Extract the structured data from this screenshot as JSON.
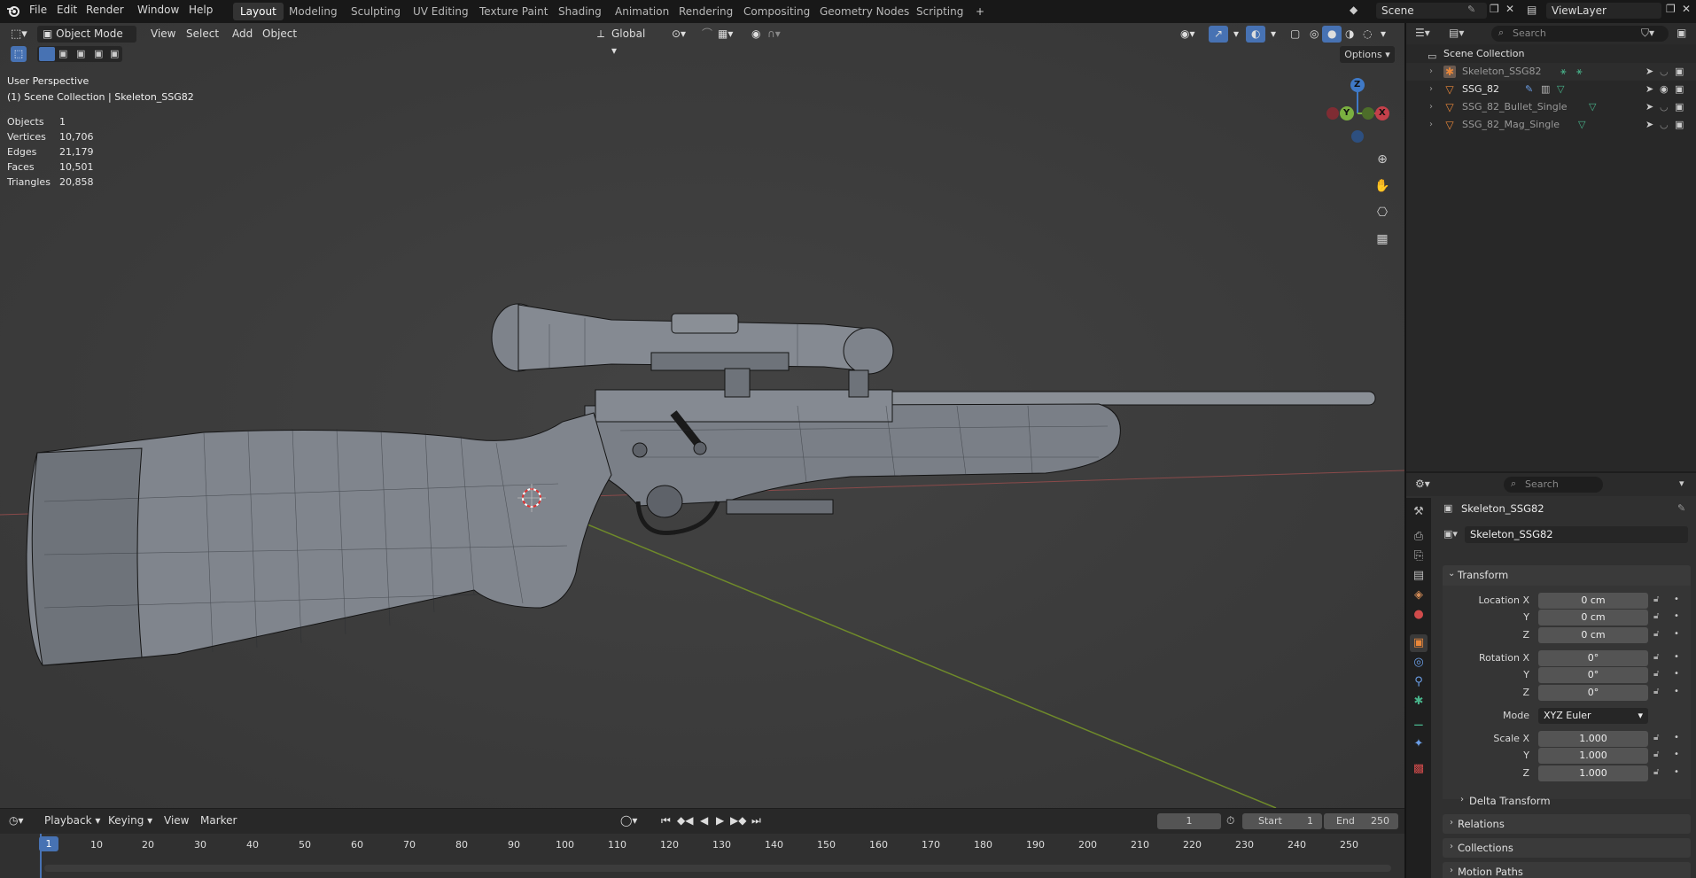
{
  "topbar": {
    "menu": [
      "File",
      "Edit",
      "Render",
      "Window",
      "Help"
    ],
    "workspaces": [
      "Layout",
      "Modeling",
      "Sculpting",
      "UV Editing",
      "Texture Paint",
      "Shading",
      "Animation",
      "Rendering",
      "Compositing",
      "Geometry Nodes",
      "Scripting"
    ],
    "active_workspace": "Layout",
    "add_tab": "+",
    "scene": "Scene",
    "view_layer": "ViewLayer"
  },
  "viewport": {
    "mode": "Object Mode",
    "menus": [
      "View",
      "Select",
      "Add",
      "Object"
    ],
    "orientation": "Global",
    "options_label": "Options",
    "perspective": "User Perspective",
    "collection_path": "(1) Scene Collection | Skeleton_SSG82",
    "stats": [
      {
        "label": "Objects",
        "value": "1"
      },
      {
        "label": "Vertices",
        "value": "10,706"
      },
      {
        "label": "Edges",
        "value": "21,179"
      },
      {
        "label": "Faces",
        "value": "10,501"
      },
      {
        "label": "Triangles",
        "value": "20,858"
      }
    ],
    "gizmo": {
      "z": "Z",
      "y": "Y",
      "x": "X"
    }
  },
  "outliner": {
    "search_placeholder": "Search",
    "root": "Scene Collection",
    "items": [
      {
        "name": "Skeleton_SSG82",
        "type": "armature",
        "dim": true
      },
      {
        "name": "SSG_82",
        "type": "mesh",
        "dim": false
      },
      {
        "name": "SSG_82_Bullet_Single",
        "type": "mesh",
        "dim": true
      },
      {
        "name": "SSG_82_Mag_Single",
        "type": "mesh",
        "dim": true
      }
    ]
  },
  "properties": {
    "search_placeholder": "Search",
    "object_name": "Skeleton_SSG82",
    "data_name": "Skeleton_SSG82",
    "transform_label": "Transform",
    "location": {
      "label_x": "Location X",
      "label_y": "Y",
      "label_z": "Z",
      "x": "0 cm",
      "y": "0 cm",
      "z": "0 cm"
    },
    "rotation": {
      "label_x": "Rotation X",
      "label_y": "Y",
      "label_z": "Z",
      "x": "0°",
      "y": "0°",
      "z": "0°"
    },
    "mode_label": "Mode",
    "mode_value": "XYZ Euler",
    "scale": {
      "label_x": "Scale X",
      "label_y": "Y",
      "label_z": "Z",
      "x": "1.000",
      "y": "1.000",
      "z": "1.000"
    },
    "delta_transform": "Delta Transform",
    "relations": "Relations",
    "collections": "Collections",
    "motion_paths": "Motion Paths"
  },
  "timeline": {
    "menus": [
      "Playback",
      "Keying",
      "View",
      "Marker"
    ],
    "current_frame": "1",
    "start_label": "Start",
    "start": "1",
    "end_label": "End",
    "end": "250",
    "ticks": [
      "1",
      "10",
      "20",
      "30",
      "40",
      "50",
      "60",
      "70",
      "80",
      "90",
      "100",
      "110",
      "120",
      "130",
      "140",
      "150",
      "160",
      "170",
      "180",
      "190",
      "200",
      "210",
      "220",
      "230",
      "240",
      "250"
    ]
  },
  "colors": {
    "accent": "#4772b3",
    "mesh": "#e8873a",
    "x_axis": "#c4404a",
    "y_axis": "#7ab040",
    "z_axis": "#3f79c6"
  }
}
